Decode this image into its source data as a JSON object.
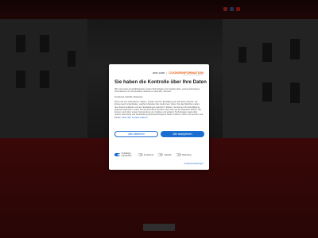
{
  "page": {
    "accent": "#1b6ed1",
    "brand_orange": "#e85a0c"
  },
  "topbar": {
    "icons": [
      "flag-icon",
      "facebook-icon",
      "youtube-icon"
    ]
  },
  "consent": {
    "brand_left": "one.com",
    "brand_sep": "|",
    "brand_right": "COOKIEINFORMATION",
    "brand_sub": "Cookie consent & compliance",
    "title": "Sie haben die Kontrolle über Ihre Daten",
    "para1": "Wir und unsere Geschäftspartner nutzen Technologien wie Cookies dazu, personenbezogene Informationen für verschiedene Zwecke zu sammeln, darunter:",
    "purposes": "Funktional, Statistik, Marketing",
    "para2": "Wenn Sie auf „Akzeptieren\" klicken, erteilen Sie Ihre Einwilligung für alle diese Zwecke. Sie können auch entscheiden, welchen Zwecken Sie zustimmen, indem Sie das Kästchen neben dem Zweck anklicken und auf „Einstellungen speichern\" klicken. Sie können Ihre Einwilligung jederzeit widerrufen, indem Sie auf das kleine Symbol unten links auf der Webseite klicken. Sie können mehr über unsere Verwendung von Cookies und anderen Technologien sowie über unsere Sammlung und Verarbeitung personenbezogener Daten erfahren, indem Sie auf den Link klicken.",
    "privacy_link": "Mehr über Cookies erfahren",
    "toggles": [
      {
        "label": "Unbedingt erforderlich",
        "on": true
      },
      {
        "label": "Funktional",
        "on": false
      },
      {
        "label": "Statistik",
        "on": false
      },
      {
        "label": "Marketing",
        "on": false
      }
    ],
    "decline_label": "Alle ablehnen",
    "accept_label": "Alle akzeptieren",
    "settings_label": "Cookie-Einstellungen"
  }
}
